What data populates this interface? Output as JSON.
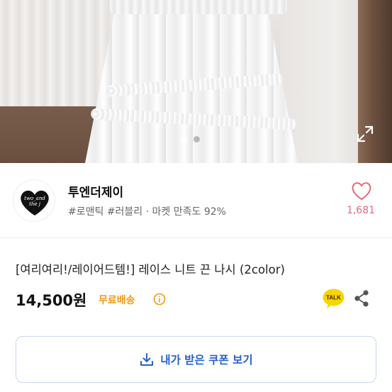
{
  "gallery": {
    "page_dots": [
      {
        "active": true
      },
      {
        "active": false
      }
    ],
    "expand_icon": "expand-icon"
  },
  "shop": {
    "logo_text_line1": "two_and",
    "logo_text_line2": "the j",
    "name": "투엔더제이",
    "tags": "#로맨틱 #러블리 · 마켓 만족도 92%",
    "like_count": "1,681",
    "like_icon": "heart-outline-icon",
    "like_color": "#e4697a"
  },
  "product": {
    "title": "[여리여리!/레이어드템!] 레이스 니트 끈 나시 (2color)",
    "price": "14,500원",
    "shipping": "무료배송",
    "shipping_color": "#f29a16",
    "info_icon": "info-circle-icon",
    "talk_label": "TALK",
    "share_icon": "share-icon"
  },
  "coupon": {
    "label": "내가 받은 쿠폰 보기",
    "icon": "download-icon",
    "color": "#2563c9"
  }
}
